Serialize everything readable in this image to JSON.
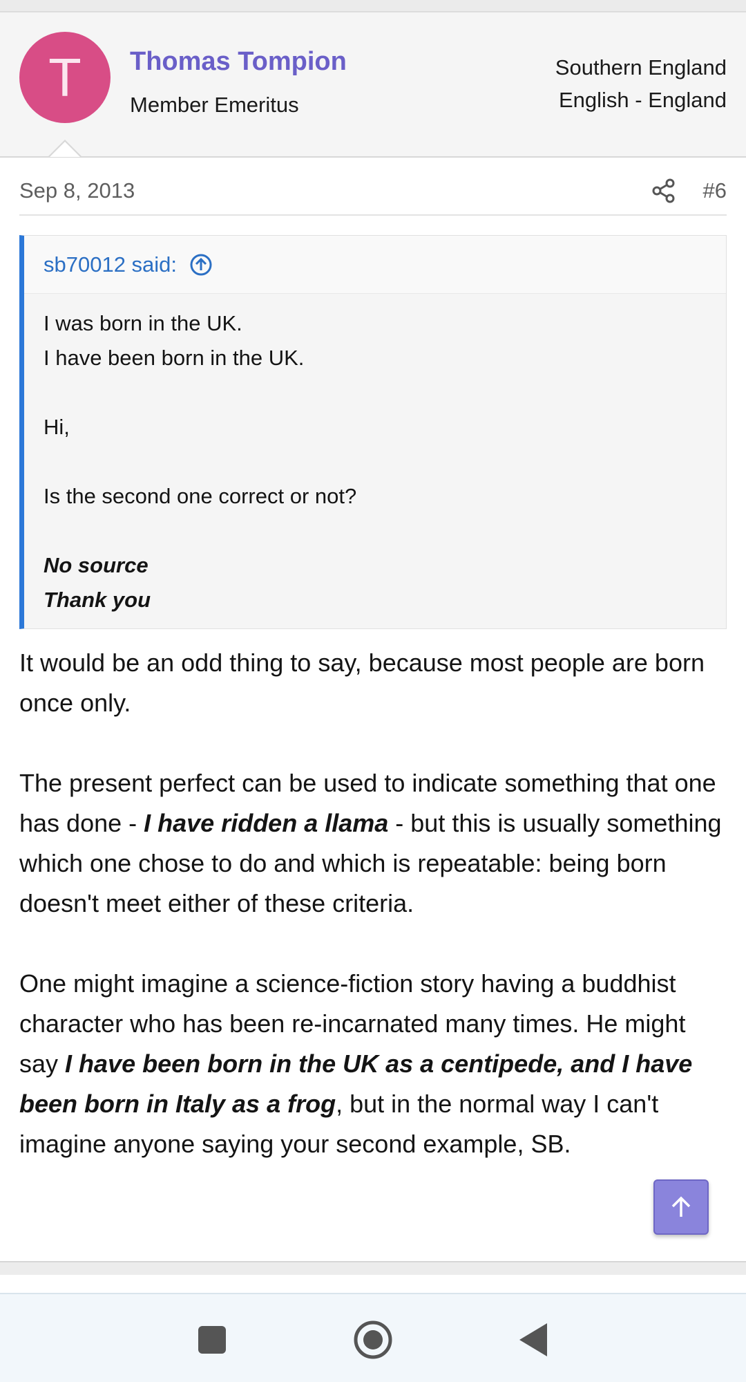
{
  "user": {
    "avatar_letter": "T",
    "name": "Thomas Tompion",
    "title": "Member Emeritus",
    "location": "Southern England",
    "language": "English - England"
  },
  "post": {
    "date": "Sep 8, 2013",
    "number": "#6"
  },
  "quote": {
    "author": "sb70012 said:",
    "lines": [
      "I was born in the UK.",
      "I have been born in the UK."
    ],
    "greeting": "Hi,",
    "question": "Is the second one correct or not?",
    "closing_bold": [
      "No source",
      "Thank you"
    ]
  },
  "body": {
    "p1": "It would be an odd thing to say, because most people are born once only.",
    "p2_before": "The present perfect can be used to indicate something that one has done - ",
    "p2_emph": "I have ridden a llama",
    "p2_after": " - but this is usually something which one chose to do and which is repeatable: being born doesn't meet either of these criteria.",
    "p3_before": "One might imagine a science-fiction story having a buddhist character who has been re-incarnated many times. He might say ",
    "p3_emph": "I have been born in the UK as a centipede, and I have been born in Italy as a frog",
    "p3_after": ", but in the normal way I can't imagine anyone saying your second example, SB."
  },
  "icons": {
    "share": "share-icon",
    "quote_jump": "arrow-up-circle-icon",
    "scroll_top": "arrow-up-icon",
    "nav_recents": "square-icon",
    "nav_home": "circle-icon",
    "nav_back": "triangle-back-icon"
  },
  "colors": {
    "username": "#6a5fc8",
    "avatar": "#d84d86",
    "quote_accent": "#2c78d8",
    "scroll_button": "#8a84dc"
  }
}
